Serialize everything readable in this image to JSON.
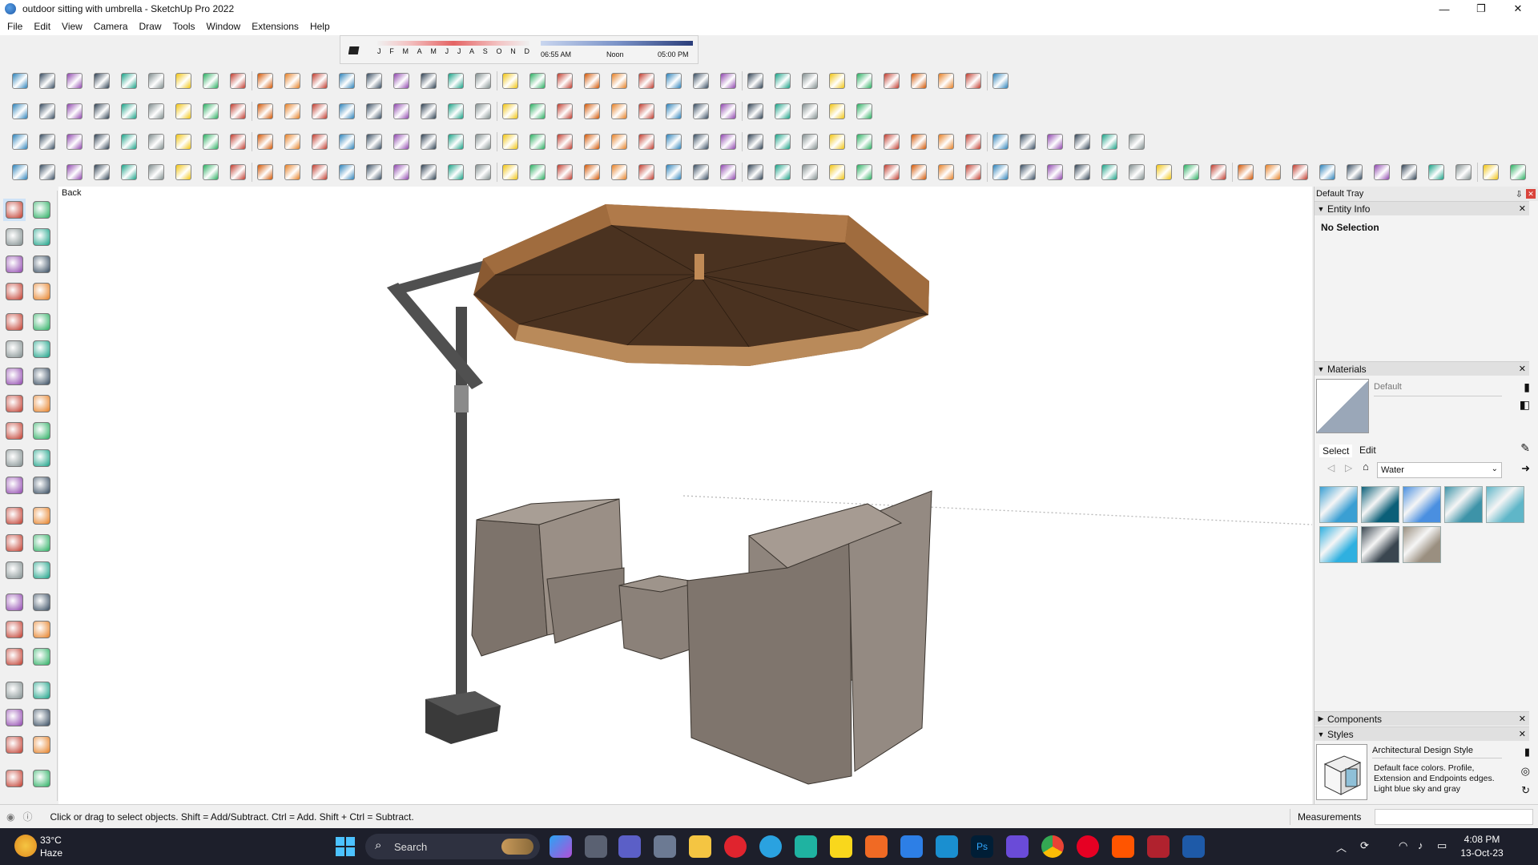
{
  "window": {
    "title": "outdoor sitting with umbrella - SketchUp Pro 2022",
    "minimize": "—",
    "maximize": "❐",
    "close": "✕"
  },
  "menu": [
    "File",
    "Edit",
    "View",
    "Camera",
    "Draw",
    "Tools",
    "Window",
    "Extensions",
    "Help"
  ],
  "shadows": {
    "months": [
      "J",
      "F",
      "M",
      "A",
      "M",
      "J",
      "J",
      "A",
      "S",
      "O",
      "N",
      "D"
    ],
    "time_start": "06:55 AM",
    "time_mid": "Noon",
    "time_end": "05:00 PM"
  },
  "viewport": {
    "scene_label": "Back"
  },
  "tray": {
    "title": "Default Tray",
    "entity_info": {
      "header": "Entity Info",
      "selection": "No Selection"
    },
    "materials": {
      "header": "Materials",
      "default_label": "Default",
      "tab_select": "Select",
      "tab_edit": "Edit",
      "library": "Water",
      "swatch_colors": [
        "#3a9fd3",
        "#0b5f78",
        "#4a8fe0",
        "#3d93a8",
        "#5fb6c8",
        "#2fb0e0",
        "#3a4650",
        "#9a8f80"
      ]
    },
    "components": {
      "header": "Components"
    },
    "styles": {
      "header": "Styles",
      "style_name": "Architectural Design Style",
      "description": "Default face colors. Profile, Extension and Endpoints edges. Light blue sky and gray"
    }
  },
  "status": {
    "message": "Click or drag to select objects. Shift = Add/Subtract. Ctrl = Add. Shift + Ctrl = Subtract.",
    "measurements_label": "Measurements"
  },
  "taskbar": {
    "weather_temp": "33°C",
    "weather_desc": "Haze",
    "search_placeholder": "Search",
    "time": "4:08 PM",
    "date": "13-Oct-23"
  }
}
